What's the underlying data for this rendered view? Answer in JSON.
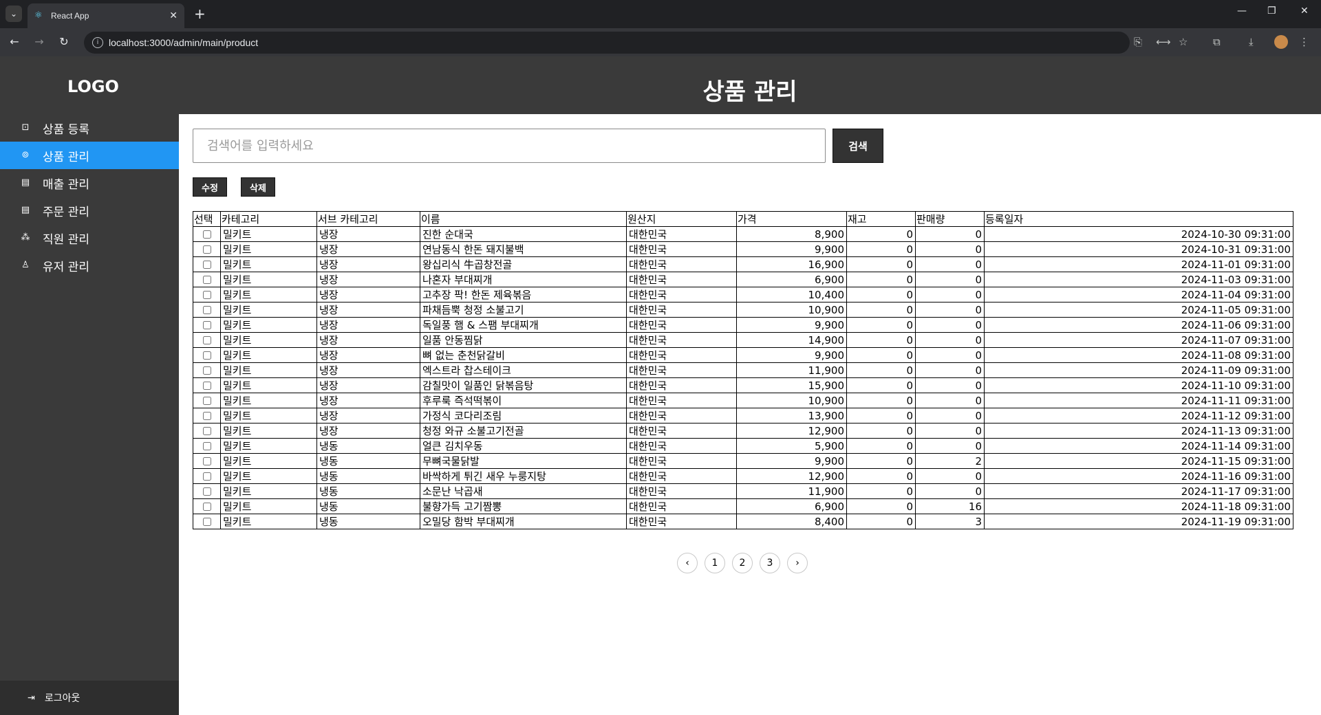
{
  "browser": {
    "tab_title": "React App",
    "url": "localhost:3000/admin/main/product"
  },
  "app": {
    "logo": "LOGO",
    "page_title": "상품 관리"
  },
  "sidebar": {
    "items": [
      {
        "label": "상품 등록",
        "icon": "bag-icon"
      },
      {
        "label": "상품 관리",
        "icon": "product-icon",
        "active": true
      },
      {
        "label": "매출 관리",
        "icon": "building-icon"
      },
      {
        "label": "주문 관리",
        "icon": "building-icon"
      },
      {
        "label": "직원 관리",
        "icon": "staff-icon"
      },
      {
        "label": "유저 관리",
        "icon": "user-icon"
      }
    ],
    "logout": "로그아웃"
  },
  "search": {
    "placeholder": "검색어를 입력하세요",
    "button": "검색"
  },
  "actions": {
    "edit": "수정",
    "delete": "삭제"
  },
  "table": {
    "headers": [
      "선택",
      "카테고리",
      "서브 카테고리",
      "이름",
      "원산지",
      "가격",
      "재고",
      "판매량",
      "등록일자"
    ],
    "rows": [
      {
        "category": "밀키트",
        "sub": "냉장",
        "name": "진한 순대국",
        "origin": "대한민국",
        "price": "8,900",
        "stock": "0",
        "sold": "0",
        "date": "2024-10-30 09:31:00"
      },
      {
        "category": "밀키트",
        "sub": "냉장",
        "name": "연남동식 한돈 돼지불백",
        "origin": "대한민국",
        "price": "9,900",
        "stock": "0",
        "sold": "0",
        "date": "2024-10-31 09:31:00"
      },
      {
        "category": "밀키트",
        "sub": "냉장",
        "name": "왕십리식 牛곱창전골",
        "origin": "대한민국",
        "price": "16,900",
        "stock": "0",
        "sold": "0",
        "date": "2024-11-01 09:31:00"
      },
      {
        "category": "밀키트",
        "sub": "냉장",
        "name": "나혼자 부대찌개",
        "origin": "대한민국",
        "price": "6,900",
        "stock": "0",
        "sold": "0",
        "date": "2024-11-03 09:31:00"
      },
      {
        "category": "밀키트",
        "sub": "냉장",
        "name": "고추장 팍! 한돈 제육볶음",
        "origin": "대한민국",
        "price": "10,400",
        "stock": "0",
        "sold": "0",
        "date": "2024-11-04 09:31:00"
      },
      {
        "category": "밀키트",
        "sub": "냉장",
        "name": "파채듬뿍 청정 소불고기",
        "origin": "대한민국",
        "price": "10,900",
        "stock": "0",
        "sold": "0",
        "date": "2024-11-05 09:31:00"
      },
      {
        "category": "밀키트",
        "sub": "냉장",
        "name": "독일풍 햄 & 스팸 부대찌개",
        "origin": "대한민국",
        "price": "9,900",
        "stock": "0",
        "sold": "0",
        "date": "2024-11-06 09:31:00"
      },
      {
        "category": "밀키트",
        "sub": "냉장",
        "name": "일품 안동찜닭",
        "origin": "대한민국",
        "price": "14,900",
        "stock": "0",
        "sold": "0",
        "date": "2024-11-07 09:31:00"
      },
      {
        "category": "밀키트",
        "sub": "냉장",
        "name": "뼈 없는 춘천닭갈비",
        "origin": "대한민국",
        "price": "9,900",
        "stock": "0",
        "sold": "0",
        "date": "2024-11-08 09:31:00"
      },
      {
        "category": "밀키트",
        "sub": "냉장",
        "name": "엑스트라 찹스테이크",
        "origin": "대한민국",
        "price": "11,900",
        "stock": "0",
        "sold": "0",
        "date": "2024-11-09 09:31:00"
      },
      {
        "category": "밀키트",
        "sub": "냉장",
        "name": "감칠맛이 일품인 닭볶음탕",
        "origin": "대한민국",
        "price": "15,900",
        "stock": "0",
        "sold": "0",
        "date": "2024-11-10 09:31:00"
      },
      {
        "category": "밀키트",
        "sub": "냉장",
        "name": "후루룩 즉석떡볶이",
        "origin": "대한민국",
        "price": "10,900",
        "stock": "0",
        "sold": "0",
        "date": "2024-11-11 09:31:00"
      },
      {
        "category": "밀키트",
        "sub": "냉장",
        "name": "가정식 코다리조림",
        "origin": "대한민국",
        "price": "13,900",
        "stock": "0",
        "sold": "0",
        "date": "2024-11-12 09:31:00"
      },
      {
        "category": "밀키트",
        "sub": "냉장",
        "name": "청정 와규 소불고기전골",
        "origin": "대한민국",
        "price": "12,900",
        "stock": "0",
        "sold": "0",
        "date": "2024-11-13 09:31:00"
      },
      {
        "category": "밀키트",
        "sub": "냉동",
        "name": "얼큰 김치우동",
        "origin": "대한민국",
        "price": "5,900",
        "stock": "0",
        "sold": "0",
        "date": "2024-11-14 09:31:00"
      },
      {
        "category": "밀키트",
        "sub": "냉동",
        "name": "무뼈국물닭발",
        "origin": "대한민국",
        "price": "9,900",
        "stock": "0",
        "sold": "2",
        "date": "2024-11-15 09:31:00"
      },
      {
        "category": "밀키트",
        "sub": "냉동",
        "name": "바싹하게 튀긴 새우 누룽지탕",
        "origin": "대한민국",
        "price": "12,900",
        "stock": "0",
        "sold": "0",
        "date": "2024-11-16 09:31:00"
      },
      {
        "category": "밀키트",
        "sub": "냉동",
        "name": "소문난 낙곱새",
        "origin": "대한민국",
        "price": "11,900",
        "stock": "0",
        "sold": "0",
        "date": "2024-11-17 09:31:00"
      },
      {
        "category": "밀키트",
        "sub": "냉동",
        "name": "불향가득 고기짬뽕",
        "origin": "대한민국",
        "price": "6,900",
        "stock": "0",
        "sold": "16",
        "date": "2024-11-18 09:31:00"
      },
      {
        "category": "밀키트",
        "sub": "냉동",
        "name": "오밀당 함박 부대찌개",
        "origin": "대한민국",
        "price": "8,400",
        "stock": "0",
        "sold": "3",
        "date": "2024-11-19 09:31:00"
      }
    ]
  },
  "pagination": {
    "prev": "‹",
    "pages": [
      "1",
      "2",
      "3"
    ],
    "next": "›"
  }
}
